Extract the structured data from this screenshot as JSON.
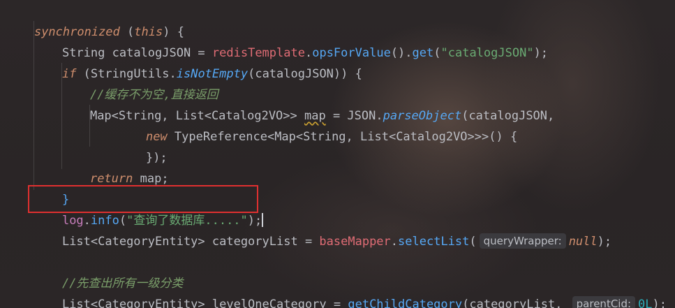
{
  "code": {
    "line1": {
      "kw": "synchronized",
      "p1": " (",
      "this": "this",
      "p2": ") {"
    },
    "line2": {
      "type": "String",
      "var": " catalogJSON = ",
      "field": "redisTemplate",
      "dot1": ".",
      "m1": "opsForValue",
      "p1": "().",
      "m2": "get",
      "p2": "(",
      "str": "\"catalogJSON\"",
      "p3": ");"
    },
    "line3": {
      "kw": "if",
      "p1": " (StringUtils.",
      "m": "isNotEmpty",
      "p2": "(catalogJSON)) {"
    },
    "line4": {
      "comment": "//缓存不为空,直接返回"
    },
    "line5": {
      "t1": "Map<String, List<Catalog2VO>> ",
      "var": "map",
      "eq": " = JSON.",
      "m": "parseObject",
      "p": "(catalogJSON,"
    },
    "line6": {
      "kw": "new",
      "rest": " TypeReference<Map<String, List<Catalog2VO>>>() {"
    },
    "line7": {
      "text": "});"
    },
    "line8": {
      "kw": "return",
      "rest": " map;"
    },
    "line9": {
      "text": "}"
    },
    "line10": {
      "obj": "log",
      "dot": ".",
      "m": "info",
      "p1": "(",
      "str": "\"查询了数据库.....\"",
      "p2": ");"
    },
    "line11": {
      "t1": "List<CategoryEntity> categoryList = ",
      "field": "baseMapper",
      "dot": ".",
      "m": "selectList",
      "p1": "(",
      "hint": "queryWrapper:",
      "null": "null",
      "p2": ");"
    },
    "line12": {
      "comment": "//先查出所有一级分类"
    },
    "line13": {
      "t1": "List<CategoryEntity> levelOneCategory = ",
      "m": "getChildCategory",
      "p1": "(categoryList, ",
      "hint": "parentCid:",
      "num": "0L",
      "p2": ");"
    }
  },
  "colors": {
    "keyword": "#cf8e6d",
    "string": "#6aab73",
    "method": "#56a8f5",
    "comment": "#7a9e6a",
    "field": "#c77dbb",
    "highlight": "#e03030"
  }
}
